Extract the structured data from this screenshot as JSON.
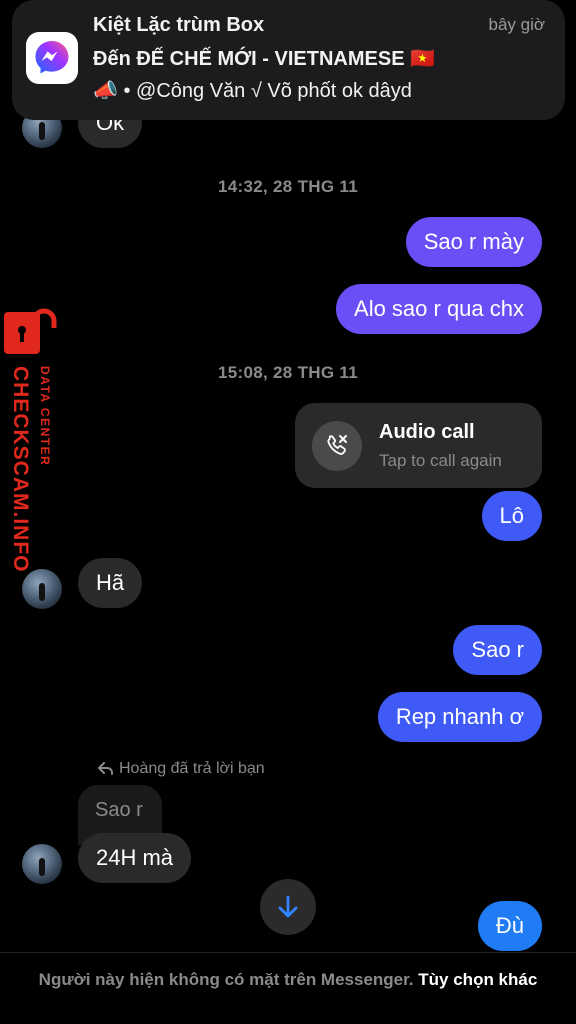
{
  "notification": {
    "title": "Kiệt Lặc trùm Box",
    "time": "bây giờ",
    "subtitle": "Đến ĐẾ CHẾ MỚI - VIETNAMESE 🇻🇳",
    "body_icon": "megaphone-icon",
    "body": "📣 • @Công Văn √ Võ  phốt ok dâyd",
    "app_icon": "messenger-icon"
  },
  "messages": {
    "partial_incoming": "Ok",
    "timestamp1": "14:32, 28 THG 11",
    "out1": "Sao r mày",
    "out2": "Alo sao r qua chx",
    "timestamp2": "15:08, 28 THG 11",
    "call_title": "Audio call",
    "call_subtitle": "Tap to call again",
    "out3": "Lô",
    "in1": "Hã",
    "out4": "Sao r",
    "out5": "Rep nhanh ơ",
    "reply_label": "Hoàng đã trả lời bạn",
    "quoted": "Sao r",
    "in2": "24H mà",
    "out6": "Đù"
  },
  "footer": {
    "text": "Người này hiện không có mặt trên Messenger.",
    "option": "Tùy chọn khác"
  },
  "watermark": {
    "main": "CHECKSCAM.INFO",
    "sub": "DATA CENTER"
  },
  "colors": {
    "purple": "#6b4ff6",
    "indigo": "#3f5af6",
    "blue": "#1f7cf5",
    "incoming": "#2a2a2a",
    "watermark_red": "#e1281c"
  }
}
